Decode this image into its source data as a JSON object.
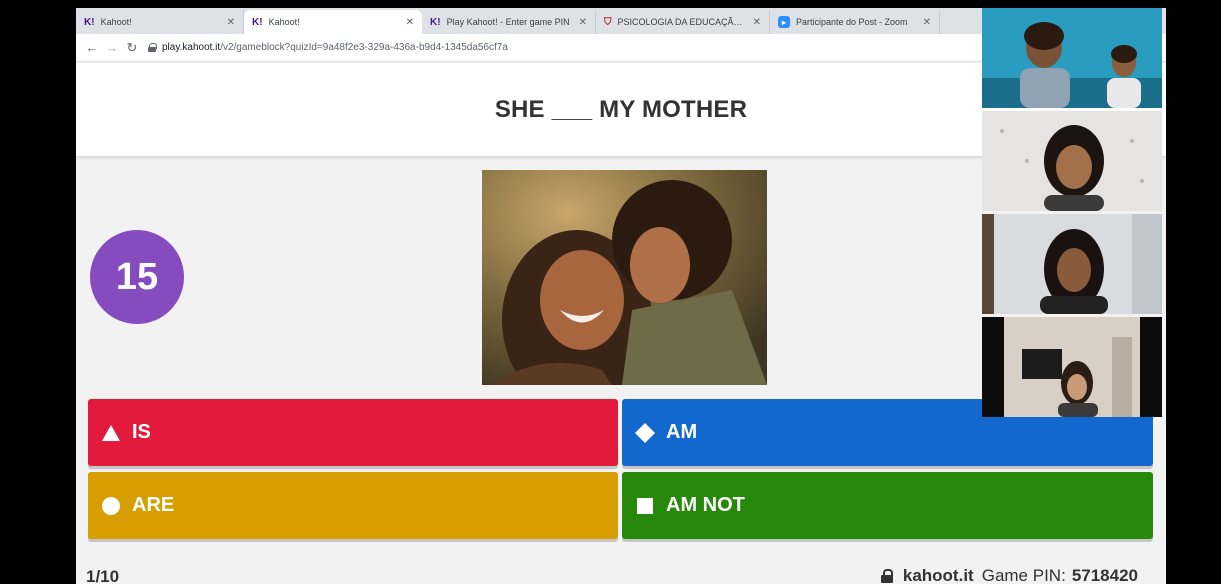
{
  "browser": {
    "tabs": [
      {
        "favicon": "K!",
        "title": "Kahoot!",
        "active": false
      },
      {
        "favicon": "K!",
        "title": "Kahoot!",
        "active": true
      },
      {
        "favicon": "K!",
        "title": "Play Kahoot! - Enter game PIN",
        "active": false
      },
      {
        "favicon": "shield-icon",
        "title": "PSICOLOGIA DA EDUCAÇÃO -",
        "active": false
      },
      {
        "favicon": "zoom-icon",
        "title": "Participante do Post - Zoom",
        "active": false
      }
    ],
    "url_host": "play.kahoot.it",
    "url_path": "/v2/gameblock?quizId=9a48f2e3-329a-436a-b9d4-1345da56cf7a"
  },
  "game": {
    "question": "SHE ___ MY MOTHER",
    "timer": "15",
    "answers": [
      {
        "shape": "triangle",
        "label": "IS",
        "color": "#e21b3c"
      },
      {
        "shape": "diamond",
        "label": "AM",
        "color": "#1368ce"
      },
      {
        "shape": "circle",
        "label": "ARE",
        "color": "#d89e00"
      },
      {
        "shape": "square",
        "label": "AM NOT",
        "color": "#26890c"
      }
    ],
    "progress": "1/10",
    "site": "kahoot.it",
    "pin_label": "Game PIN:",
    "pin": "5718420"
  },
  "colors": {
    "timer_purple": "#864cbf",
    "background": "#f2f2f2"
  }
}
